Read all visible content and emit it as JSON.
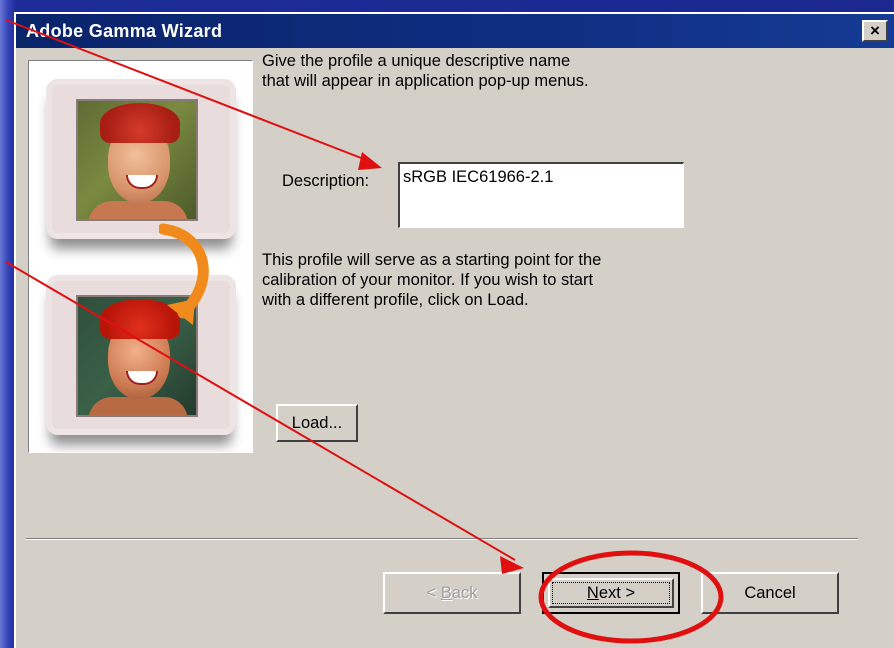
{
  "window": {
    "title": "Adobe Gamma Wizard",
    "close_glyph": "×"
  },
  "content": {
    "intro_line1": "Give the profile a unique descriptive name",
    "intro_line2": "that will appear in application pop-up menus.",
    "description_label": "Description:",
    "description_value": "sRGB IEC61966-2.1",
    "info_line1": "This profile will serve as a starting point for the",
    "info_line2": "calibration of your monitor. If you wish to start",
    "info_line3": "with a different profile, click on Load.",
    "load_label": "Load..."
  },
  "footer": {
    "back_accel": "B",
    "back_rest": "ack",
    "back_prefix": "< ",
    "next_accel": "N",
    "next_rest": "ext >",
    "cancel_label": "Cancel"
  },
  "colors": {
    "annotation_red": "#e01010",
    "titlebar": "#0a246a",
    "dialog_face": "#d4d0c8",
    "arrow_orange": "#f08a1c"
  },
  "icons": {
    "close": "close-icon",
    "curve_arrow": "curved-arrow-icon"
  }
}
